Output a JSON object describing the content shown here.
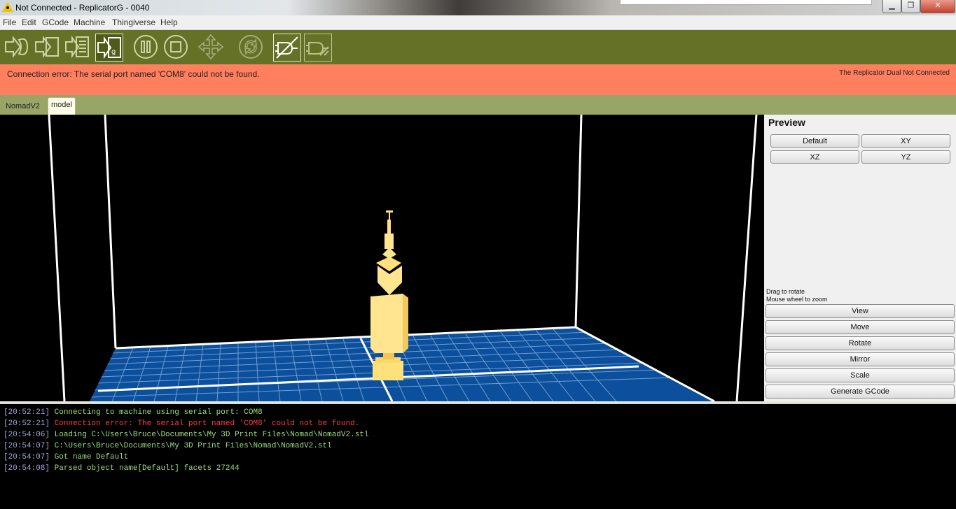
{
  "window": {
    "title": "Not Connected - ReplicatorG - 0040",
    "min_symbol": "▁",
    "max_symbol": "❐",
    "close_symbol": "✕",
    "icon": "warning-icon"
  },
  "menu": [
    "File",
    "Edit",
    "GCode",
    "Machine",
    "Thingiverse",
    "Help"
  ],
  "toolbar": {
    "buttons": [
      {
        "name": "build-button",
        "icon": "arrow-into-object-icon"
      },
      {
        "name": "build-to-file-button",
        "icon": "arrow-into-file-icon"
      },
      {
        "name": "upload-to-sd-button",
        "icon": "arrow-into-list-icon"
      },
      {
        "name": "build-from-sd-button",
        "icon": "arrow-into-gcode-icon"
      },
      {
        "name": "pause-button",
        "icon": "pause-icon"
      },
      {
        "name": "stop-button",
        "icon": "stop-icon"
      },
      {
        "name": "control-panel-button",
        "icon": "move-arrows-icon"
      },
      {
        "name": "reset-button",
        "icon": "reset-cycle-icon"
      },
      {
        "name": "connect-button",
        "icon": "plug-connect-icon"
      },
      {
        "name": "disconnect-button",
        "icon": "plug-disconnect-icon"
      }
    ]
  },
  "status": {
    "message": "Connection error: The serial port named 'COM8' could not be found.",
    "machine": "The Replicator Dual Not Connected",
    "color": "#ff7f5e"
  },
  "tabs": [
    {
      "label": "NomadV2",
      "active": false
    },
    {
      "label": "model",
      "active": true
    }
  ],
  "preview": {
    "title": "Preview",
    "view_buttons": [
      "Default",
      "XY",
      "XZ",
      "YZ"
    ],
    "hint_rotate": "Drag to rotate",
    "hint_zoom": "Mouse wheel to zoom",
    "tool_buttons": [
      "View",
      "Move",
      "Rotate",
      "Mirror",
      "Scale",
      "Generate GCode"
    ]
  },
  "console": {
    "lines": [
      {
        "time": "[20:52:21]",
        "text": "Connecting to machine using serial port: COM8",
        "type": "info"
      },
      {
        "time": "[20:52:21]",
        "text": "Connection error: The serial port named 'COM8' could not be found.",
        "type": "error"
      },
      {
        "time": "[20:54:06]",
        "text": "Loading C:\\Users\\Bruce\\Documents\\My 3D Print Files\\Nomad\\NomadV2.stl",
        "type": "info"
      },
      {
        "time": "[20:54:07]",
        "text": "C:\\Users\\Bruce\\Documents\\My 3D Print Files\\Nomad\\NomadV2.stl",
        "type": "info"
      },
      {
        "time": "[20:54:07]",
        "text": "Got name Default",
        "type": "info"
      },
      {
        "time": "[20:54:08]",
        "text": "Parsed object name[Default] facets 27244",
        "type": "info"
      }
    ]
  }
}
